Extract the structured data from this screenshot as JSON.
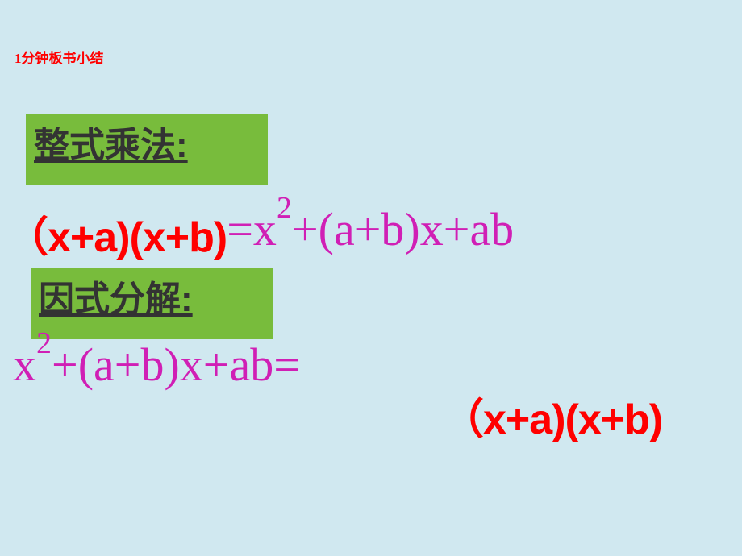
{
  "header": {
    "note": "1分钟板书小结"
  },
  "section1": {
    "label": "整式乘法:",
    "lhs": "（x+a)(x+b)",
    "rhs": "=x²+(a+b)x+ab"
  },
  "section2": {
    "label": "因式分解:",
    "lhs": "x²+(a+b)x+ab=",
    "rhs": "（x+a)(x+b)"
  }
}
